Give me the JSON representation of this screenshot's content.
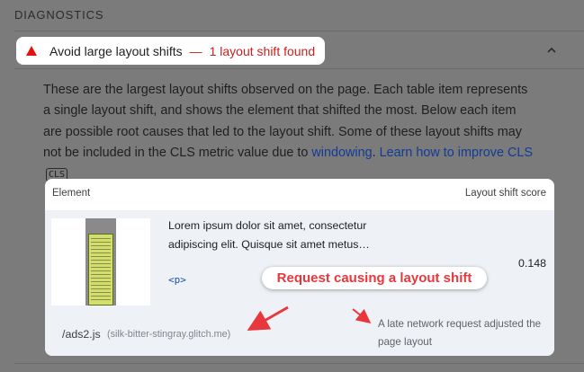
{
  "section": {
    "title": "DIAGNOSTICS"
  },
  "audit": {
    "title": "Avoid large layout shifts",
    "dash": "—",
    "display_value": "1 layout shift found",
    "fail_color": "#e3120b"
  },
  "description": {
    "text": "These are the largest layout shifts observed on the page. Each table item represents a single layout shift, and shows the element that shifted the most. Below each item are possible root causes that led to the layout shift. Some of these layout shifts may not be included in the CLS metric value due to ",
    "link_windowing": "windowing",
    "separator": ".",
    "link_learn": "Learn how to improve CLS",
    "badge": "CLS"
  },
  "table": {
    "headers": {
      "element": "Element",
      "score": "Layout shift score"
    },
    "rows": [
      {
        "snippet": "Lorem ipsum dolor sit amet, consectetur adipiscing elit. Quisque sit amet metus…",
        "node_tag": "<p>",
        "score": "0.148"
      }
    ],
    "subitem": {
      "url_path": "/ads2.js",
      "url_host": "(silk-bitter-stingray.glitch.me)",
      "cause": "A late network request adjusted the page layout"
    }
  },
  "callout": {
    "text": "Request causing a layout shift",
    "color": "#e8373d"
  },
  "icons": {
    "fail": "warning-triangle-icon",
    "collapse": "chevron-up-icon",
    "arrows": "arrow-icon"
  }
}
